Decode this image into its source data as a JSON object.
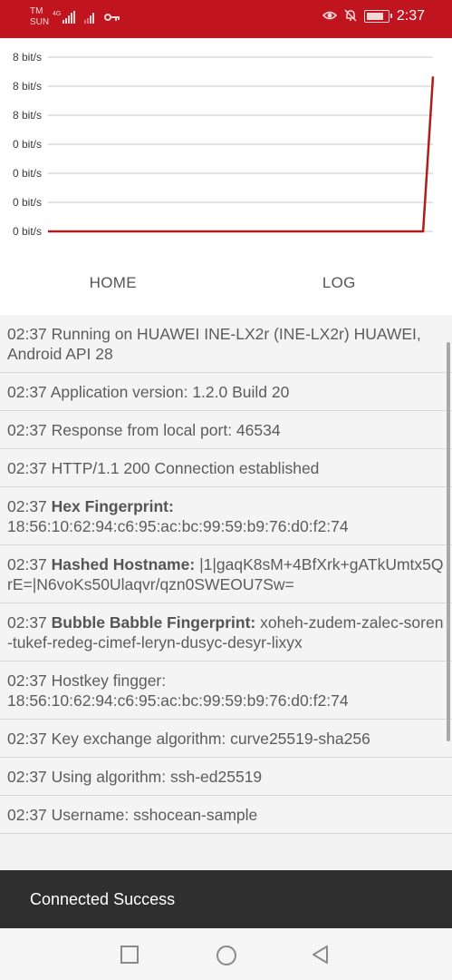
{
  "status_bar": {
    "carrier_line1": "TM",
    "carrier_line2": "SUN",
    "network_type": "4G",
    "time": "2:37",
    "icons": [
      "signal-icon",
      "signal-icon",
      "key-icon",
      "eye-icon",
      "bell-off-icon",
      "battery-icon"
    ]
  },
  "chart": {
    "y_tick_labels": [
      "8 bit/s",
      "8 bit/s",
      "8 bit/s",
      "0 bit/s",
      "0 bit/s",
      "0 bit/s",
      "0 bit/s"
    ],
    "line_color": "#b01c1c",
    "grid_color": "#c8c8c8"
  },
  "chart_data": {
    "type": "line",
    "title": "",
    "xlabel": "",
    "ylabel": "",
    "y_tick_labels": [
      "8 bit/s",
      "8 bit/s",
      "8 bit/s",
      "0 bit/s",
      "0 bit/s",
      "0 bit/s",
      "0 bit/s"
    ],
    "series": [
      {
        "values": [
          0,
          0,
          0,
          0,
          0,
          0,
          0,
          0,
          0,
          0,
          0,
          0,
          0,
          0,
          0,
          0,
          0,
          0,
          0,
          0,
          0,
          0,
          0,
          0,
          0,
          0,
          0,
          0,
          0,
          0,
          0,
          0,
          0,
          0,
          0,
          0,
          0,
          0,
          0,
          8
        ]
      }
    ],
    "ylim": [
      0,
      9
    ],
    "grid": true
  },
  "tabs": [
    {
      "label": "HOME"
    },
    {
      "label": "LOG"
    }
  ],
  "log": [
    {
      "time": "02:37",
      "label": "",
      "text": "Running on HUAWEI INE-LX2r (INE-LX2r) HUAWEI, Android API 28"
    },
    {
      "time": "02:37",
      "label": "",
      "text": "Application version: 1.2.0 Build 20"
    },
    {
      "time": "02:37",
      "label": "",
      "text": "Response from local port: 46534"
    },
    {
      "time": "02:37",
      "label": "",
      "text": "HTTP/1.1 200 Connection established"
    },
    {
      "time": "02:37",
      "label": "Hex Fingerprint:",
      "text": "18:56:10:62:94:c6:95:ac:bc:99:59:b9:76:d0:f2:74"
    },
    {
      "time": "02:37",
      "label": "Hashed Hostname:",
      "text": "|1|gaqK8sM+4BfXrk+gATkUmtx5QrE=|N6voKs50Ulaqvr/qzn0SWEOU7Sw="
    },
    {
      "time": "02:37",
      "label": "Bubble Babble Fingerprint:",
      "text": "xoheh-zudem-zalec-soren-tukef-redeg-cimef-leryn-dusyc-desyr-lixyx"
    },
    {
      "time": "02:37",
      "label": "",
      "text": "Hostkey fingger: 18:56:10:62:94:c6:95:ac:bc:99:59:b9:76:d0:f2:74"
    },
    {
      "time": "02:37",
      "label": "",
      "text": "Key exchange algorithm: curve25519-sha256"
    },
    {
      "time": "02:37",
      "label": "",
      "text": "Using algorithm: ssh-ed25519"
    },
    {
      "time": "02:37",
      "label": "",
      "text": "Username: sshocean-sample"
    }
  ],
  "toast": {
    "text": "Connected Success"
  },
  "nav": [
    {
      "icon": "recent-apps-icon"
    },
    {
      "icon": "home-circle-icon"
    },
    {
      "icon": "back-triangle-icon"
    }
  ]
}
